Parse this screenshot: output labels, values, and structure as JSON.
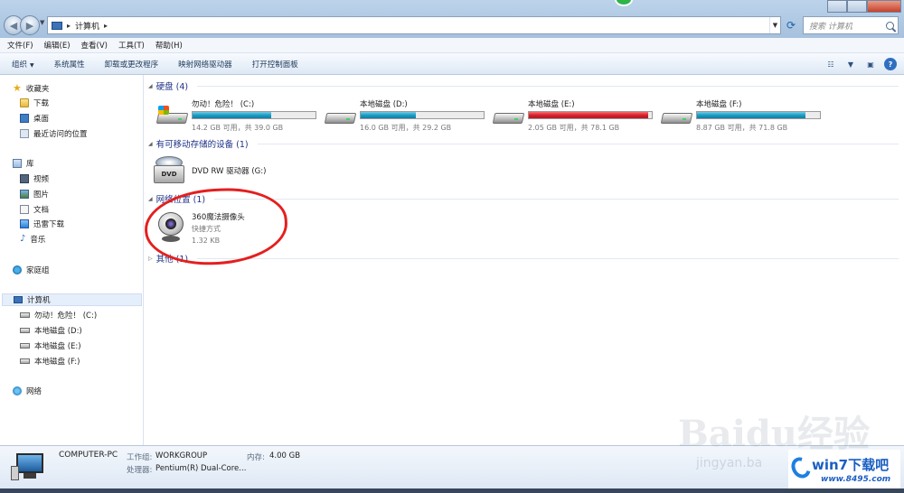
{
  "address": {
    "path": [
      "计算机"
    ],
    "search_placeholder": "搜索 计算机"
  },
  "menu": [
    "文件(F)",
    "编辑(E)",
    "查看(V)",
    "工具(T)",
    "帮助(H)"
  ],
  "toolbar": {
    "organize": "组织",
    "items": [
      "系统属性",
      "卸载或更改程序",
      "映射网络驱动器",
      "打开控制面板"
    ]
  },
  "sidebar": {
    "favorites": "收藏夹",
    "favorites_items": [
      "下载",
      "桌面",
      "最近访问的位置"
    ],
    "libraries": "库",
    "library_items": [
      "视频",
      "图片",
      "文档",
      "迅雷下载",
      "音乐"
    ],
    "homegroup": "家庭组",
    "computer": "计算机",
    "drives": [
      "勿动！危险！ (C:)",
      "本地磁盘 (D:)",
      "本地磁盘 (E:)",
      "本地磁盘 (F:)"
    ],
    "network": "网络"
  },
  "groups": {
    "hard_disks": "硬盘 (4)",
    "removable": "有可移动存储的设备 (1)",
    "network": "网络位置 (1)",
    "other": "其他 (1)"
  },
  "drives": [
    {
      "name": "勿动！危险！ (C:)",
      "info": "14.2 GB 可用，共 39.0 GB",
      "used_fraction": 0.64,
      "warn": false
    },
    {
      "name": "本地磁盘 (D:)",
      "info": "16.0 GB 可用，共 29.2 GB",
      "used_fraction": 0.45,
      "warn": false
    },
    {
      "name": "本地磁盘 (E:)",
      "info": "2.05 GB 可用，共 78.1 GB",
      "used_fraction": 0.97,
      "warn": true
    },
    {
      "name": "本地磁盘 (F:)",
      "info": "8.87 GB 可用，共 71.8 GB",
      "used_fraction": 0.88,
      "warn": false
    }
  ],
  "dvd": {
    "name": "DVD RW 驱动器 (G:)",
    "icon_text": "DVD"
  },
  "network_item": {
    "name": "360魔法摄像头",
    "type": "快捷方式",
    "size": "1.32 KB"
  },
  "details": {
    "computer_name": "COMPUTER-PC",
    "workgroup_label": "工作组:",
    "workgroup": "WORKGROUP",
    "memory_label": "内存:",
    "memory": "4.00 GB",
    "cpu_label": "处理器:",
    "cpu": "Pentium(R) Dual-Core..."
  },
  "watermark": {
    "baidu": "Baidu经验",
    "jingyan": "jingyan.ba"
  },
  "logo": {
    "brand": "win7下载吧",
    "url": "www.8495.com"
  },
  "colors": {
    "bar_normal": "#1e9cc4",
    "bar_warn": "#d4232e",
    "annotation": "#e41f1f"
  }
}
